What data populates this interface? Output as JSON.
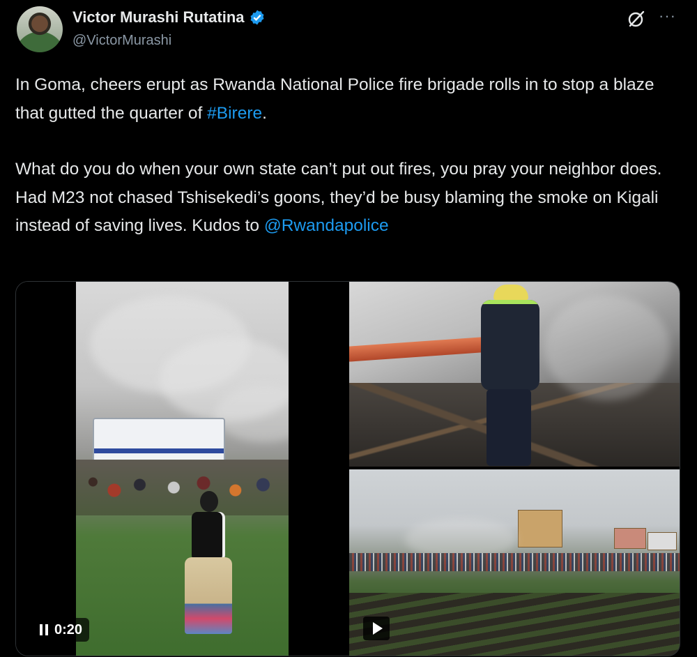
{
  "author": {
    "name": "Victor Murashi Rutatina",
    "handle": "@VictorMurashi",
    "verified": true,
    "verified_color": "#1d9bf0"
  },
  "header_actions": {
    "grok_icon": "grok-slash-circle-icon",
    "more_label": "···"
  },
  "tweet": {
    "p1_pre": "In Goma, cheers erupt as Rwanda National Police  fire brigade rolls in to stop a blaze that gutted the quarter of ",
    "p1_hashtag": "#Birere",
    "p1_post": ".",
    "p2_pre": "What do you do when your own state can’t put out fires, you pray your neighbor does. Had M23 not chased Tshisekedi’s goons, they’d be busy blaming the smoke on Kigali instead of saving lives. Kudos to ",
    "p2_mention": "@Rwandapolice",
    "link_color": "#1d9bf0"
  },
  "media": {
    "video1": {
      "timestamp": "0:20",
      "state": "playing"
    },
    "image2": {
      "subject": "firefighter-hose"
    },
    "video3": {
      "state": "paused"
    }
  }
}
